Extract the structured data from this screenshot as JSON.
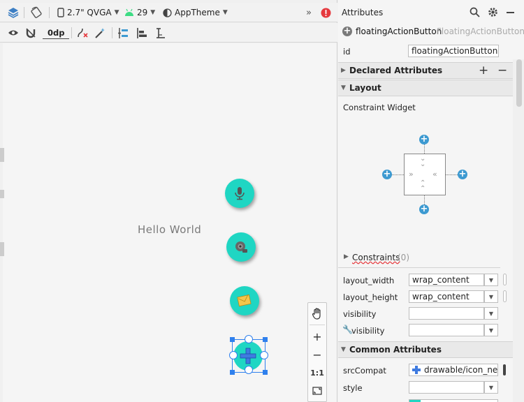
{
  "toolbar_top": {
    "device": "2.7\" QVGA",
    "api_level": "29",
    "theme": "AppTheme",
    "overflow": "»"
  },
  "toolbar_second": {
    "margin_value": "0dp"
  },
  "canvas": {
    "hello_text": "Hello World",
    "fabs": [
      "microphone-icon",
      "camera-icon",
      "email-icon",
      "add-icon"
    ],
    "fab_color": "#1fd6c3"
  },
  "zoom": {
    "plus": "+",
    "minus": "−",
    "one_to_one": "1:1"
  },
  "panel": {
    "title": "Attributes",
    "component_name": "floatingActionButton",
    "component_class": "FloatingActionButton",
    "id_label": "id",
    "id_value": "floatingActionButton",
    "declared_section": "Declared Attributes",
    "layout_section": "Layout",
    "constraint_widget": "Constraint Widget",
    "constraints_label": "Constraints",
    "constraints_count": "(0)",
    "layout_width_label": "layout_width",
    "layout_width_value": "wrap_content",
    "layout_height_label": "layout_height",
    "layout_height_value": "wrap_content",
    "visibility_label": "visibility",
    "tools_visibility_label": "visibility",
    "common_section": "Common Attributes",
    "src_compat_label": "srcCompat",
    "src_compat_value": "drawable/icon_new",
    "style_label": "style",
    "accent_color": "#3d9ad1"
  }
}
